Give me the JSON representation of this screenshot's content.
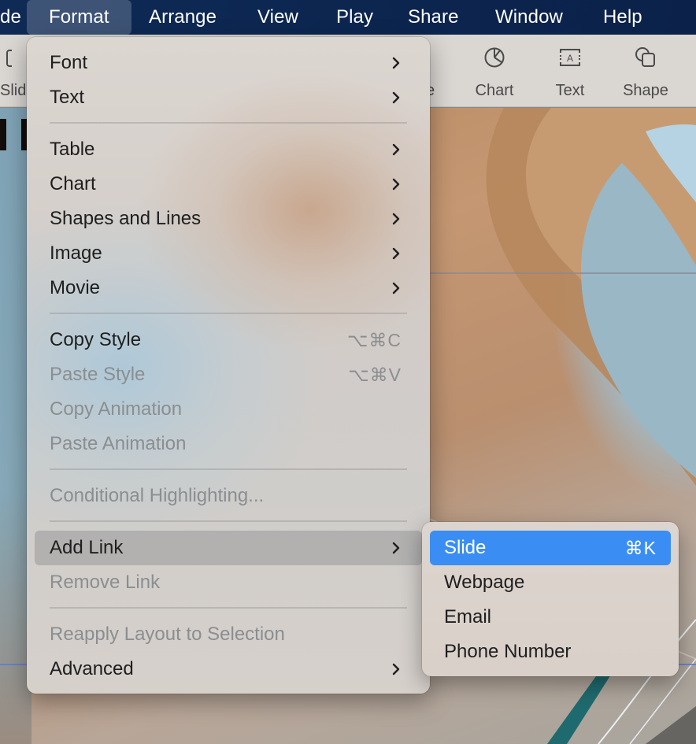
{
  "menubar": {
    "items": [
      {
        "label": "de",
        "active": false
      },
      {
        "label": "Format",
        "active": true
      },
      {
        "label": "Arrange",
        "active": false
      },
      {
        "label": "View",
        "active": false
      },
      {
        "label": "Play",
        "active": false
      },
      {
        "label": "Share",
        "active": false
      },
      {
        "label": "Window",
        "active": false
      },
      {
        "label": "Help",
        "active": false
      }
    ]
  },
  "toolbar": {
    "partial_left_label": "Slid",
    "partial_left_icon": "add-slide-icon",
    "partial_mid_label": "e",
    "items": [
      {
        "label": "Chart",
        "icon": "chart-pie-icon"
      },
      {
        "label": "Text",
        "icon": "text-box-icon"
      },
      {
        "label": "Shape",
        "icon": "shape-icon"
      }
    ]
  },
  "format_menu": {
    "title": "Format",
    "items": [
      {
        "label": "Font",
        "submenu": true,
        "enabled": true
      },
      {
        "label": "Text",
        "submenu": true,
        "enabled": true
      },
      {
        "label": "Table",
        "submenu": true,
        "enabled": true
      },
      {
        "label": "Chart",
        "submenu": true,
        "enabled": true
      },
      {
        "label": "Shapes and Lines",
        "submenu": true,
        "enabled": true
      },
      {
        "label": "Image",
        "submenu": true,
        "enabled": true
      },
      {
        "label": "Movie",
        "submenu": true,
        "enabled": true
      },
      {
        "label": "Copy Style",
        "shortcut": "⌥⌘C",
        "enabled": true
      },
      {
        "label": "Paste Style",
        "shortcut": "⌥⌘V",
        "enabled": false
      },
      {
        "label": "Copy Animation",
        "enabled": false
      },
      {
        "label": "Paste Animation",
        "enabled": false
      },
      {
        "label": "Conditional Highlighting...",
        "enabled": false
      },
      {
        "label": "Add Link",
        "submenu": true,
        "enabled": true,
        "highlighted": true
      },
      {
        "label": "Remove Link",
        "enabled": false
      },
      {
        "label": "Reapply Layout to Selection",
        "enabled": false
      },
      {
        "label": "Advanced",
        "submenu": true,
        "enabled": true
      }
    ]
  },
  "add_link_submenu": {
    "items": [
      {
        "label": "Slide",
        "shortcut": "⌘K",
        "selected": true
      },
      {
        "label": "Webpage"
      },
      {
        "label": "Email"
      },
      {
        "label": "Phone Number"
      }
    ]
  },
  "colors": {
    "menubar_bg": "#0c2650",
    "selection_blue": "#3a8ef3",
    "disabled_text": "#8b8e90",
    "guide_line": "#5a7bd8"
  }
}
